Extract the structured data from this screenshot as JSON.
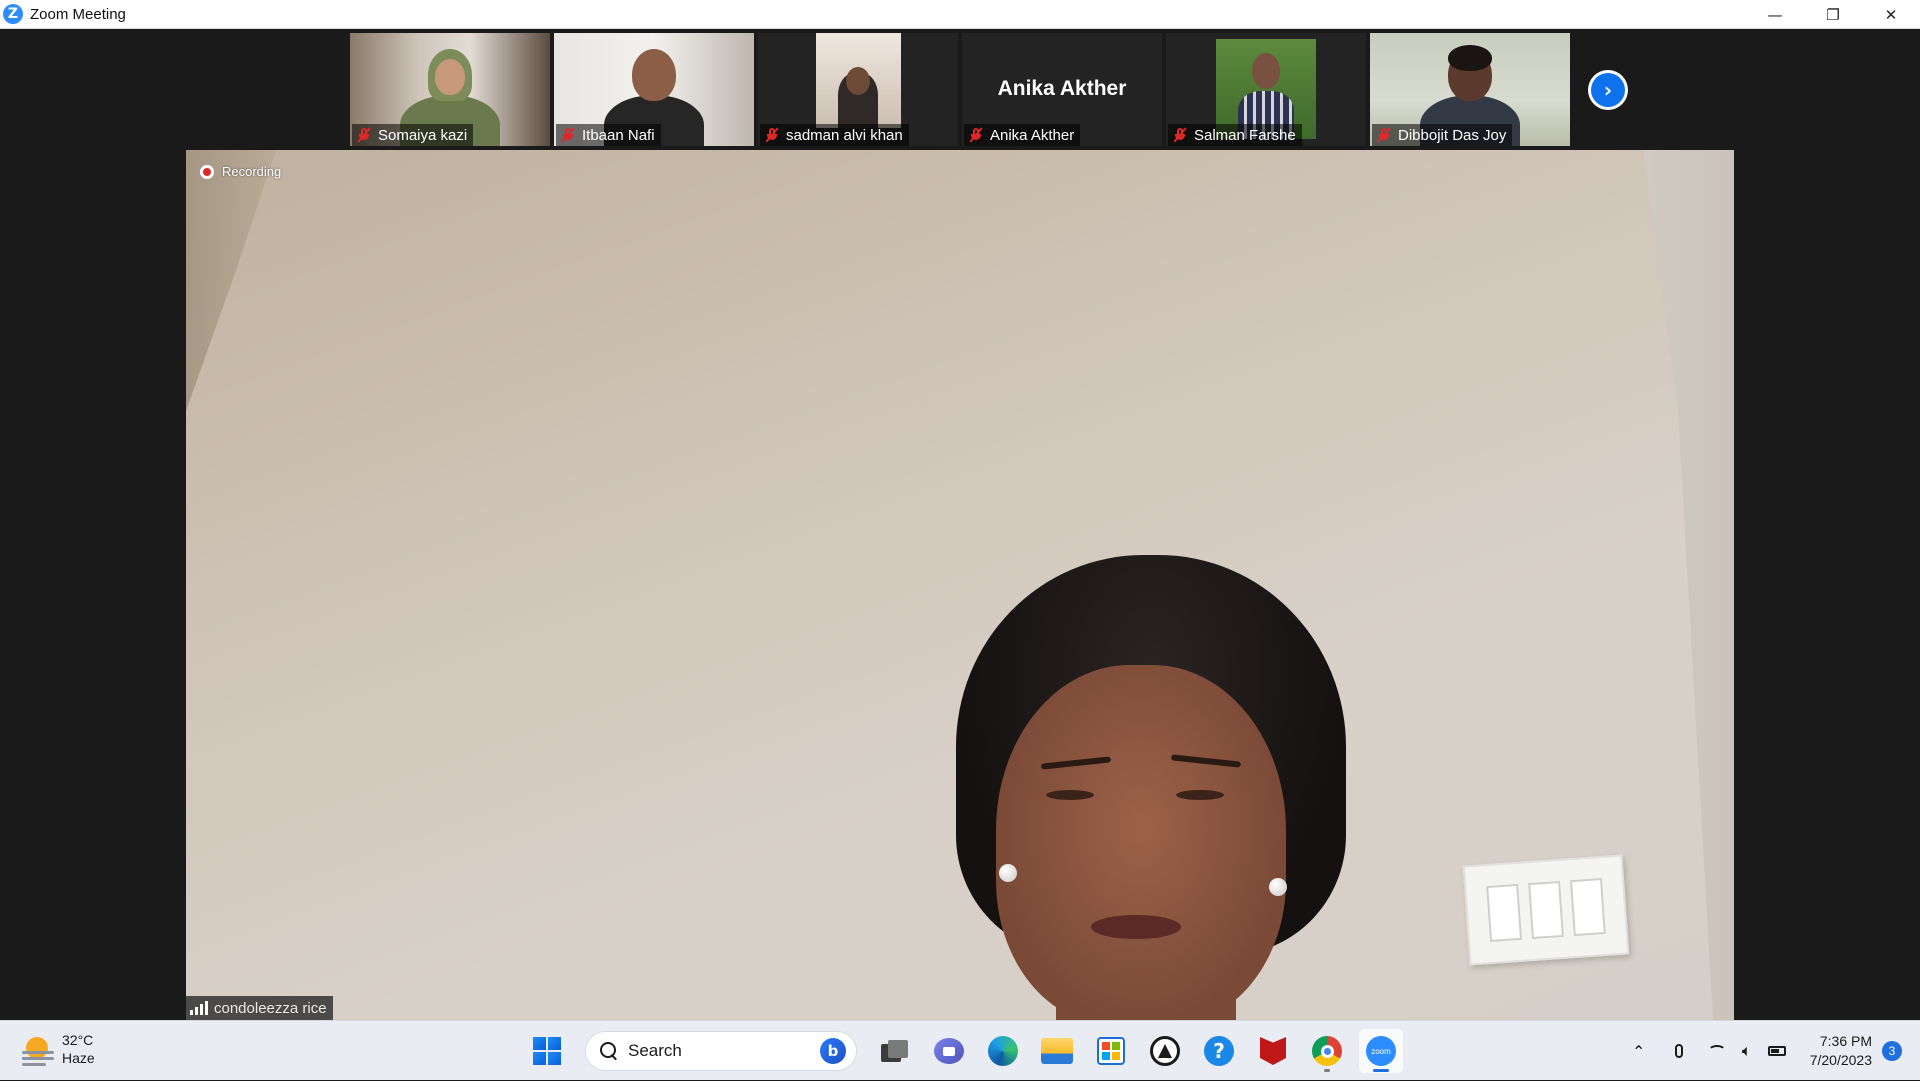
{
  "window": {
    "title": "Zoom Meeting",
    "controls": {
      "minimize": "—",
      "restore": "❐",
      "close": "✕"
    }
  },
  "participants": [
    {
      "name": "Somaiya kazi",
      "muted": true,
      "video": true
    },
    {
      "name": "Itbaan Nafi",
      "muted": true,
      "video": true
    },
    {
      "name": "sadman alvi khan",
      "muted": true,
      "video": true
    },
    {
      "name": "Anika Akther",
      "muted": true,
      "video": false,
      "display_name": "Anika Akther"
    },
    {
      "name": "Salman Farshe",
      "muted": true,
      "video": true
    },
    {
      "name": "Dibbojit Das Joy",
      "muted": true,
      "video": true
    }
  ],
  "next_page_icon": "chevron-right-icon",
  "main_video": {
    "recording_label": "Recording",
    "speaker_name": "condoleezza rice"
  },
  "taskbar": {
    "weather": {
      "temp": "32°C",
      "condition": "Haze"
    },
    "search_label": "Search",
    "pinned": [
      "windows-start-icon",
      "task-view-icon",
      "teams-chat-icon",
      "edge-icon",
      "file-explorer-icon",
      "microsoft-store-icon",
      "app-icon",
      "help-icon",
      "mcafee-icon",
      "chrome-icon",
      "zoom-icon"
    ],
    "zoom_label": "zoom",
    "clock": {
      "time": "7:36 PM",
      "date": "7/20/2023"
    },
    "notifications": "3"
  },
  "colors": {
    "zoom_blue": "#2d8cff",
    "mute_red": "#e02828",
    "taskbar_bg": "#e9edf3",
    "accent_blue": "#1f6fe0"
  }
}
